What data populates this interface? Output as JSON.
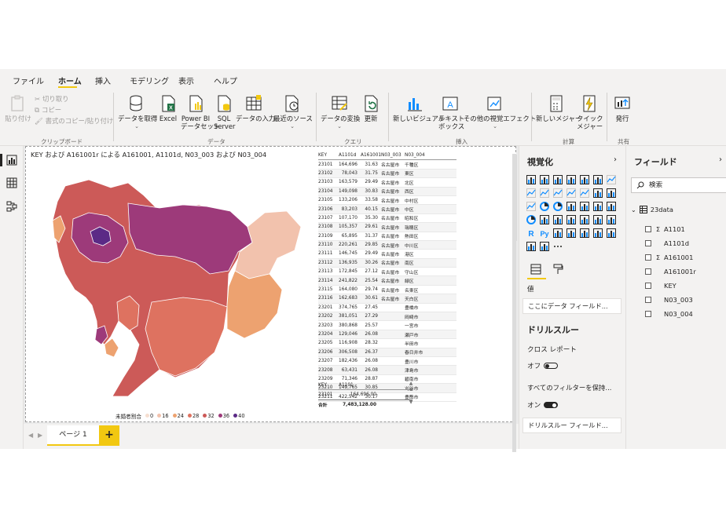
{
  "menu": {
    "tabs": [
      "ファイル",
      "ホーム",
      "挿入",
      "モデリング",
      "表示",
      "ヘルプ"
    ],
    "active": "ホーム"
  },
  "ribbon": {
    "clipboard": {
      "paste": "貼り付け",
      "cut": "切り取り",
      "copy": "コピー",
      "format_painter": "書式のコピー/貼り付け",
      "label": "クリップボード"
    },
    "data": {
      "get_data": "データを取得",
      "excel": "Excel",
      "pbi_dataset_1": "Power BI",
      "pbi_dataset_2": "データセット",
      "sql_1": "SQL",
      "sql_2": "Server",
      "enter_data": "データの入力",
      "recent_sources": "最近のソース",
      "label": "データ"
    },
    "queries": {
      "transform": "データの変換",
      "refresh": "更新",
      "label": "クエリ"
    },
    "insert": {
      "new_visual": "新しいビジュアル",
      "textbox_1": "テキスト",
      "textbox_2": "ボックス",
      "more_visuals": "その他の視覚エフェクト",
      "label": "挿入"
    },
    "calculations": {
      "new_measure": "新しいメジャー",
      "quick_measure_1": "クイック",
      "quick_measure_2": "メジャー",
      "label": "計算"
    },
    "share": {
      "publish": "発行",
      "label": "共有"
    }
  },
  "report": {
    "map_title": "KEY および A161001r による A161001, A1101d, N03_003 および N03_004",
    "legend": {
      "title": "未婚者割合",
      "items": [
        {
          "label": "0",
          "color": "#f6ded0"
        },
        {
          "label": "16",
          "color": "#f2c2ad"
        },
        {
          "label": "24",
          "color": "#eda270"
        },
        {
          "label": "28",
          "color": "#de7260"
        },
        {
          "label": "32",
          "color": "#cc5a58"
        },
        {
          "label": "36",
          "color": "#9d3a7a"
        },
        {
          "label": "40",
          "color": "#5b2a86"
        }
      ]
    },
    "table1": {
      "headers": [
        "KEY",
        "A1101d",
        "A161001",
        "N03_003",
        "N03_004"
      ],
      "rows": [
        [
          "23101",
          "164,696",
          "31.63",
          "名古屋市",
          "千種区"
        ],
        [
          "23102",
          "78,043",
          "31.75",
          "名古屋市",
          "東区"
        ],
        [
          "23103",
          "163,579",
          "29.49",
          "名古屋市",
          "北区"
        ],
        [
          "23104",
          "149,098",
          "30.83",
          "名古屋市",
          "西区"
        ],
        [
          "23105",
          "133,206",
          "33.58",
          "名古屋市",
          "中村区"
        ],
        [
          "23106",
          "83,203",
          "40.15",
          "名古屋市",
          "中区"
        ],
        [
          "23107",
          "107,170",
          "35.30",
          "名古屋市",
          "昭和区"
        ],
        [
          "23108",
          "105,357",
          "29.61",
          "名古屋市",
          "瑞穂区"
        ],
        [
          "23109",
          "65,895",
          "31.37",
          "名古屋市",
          "熱田区"
        ],
        [
          "23110",
          "220,261",
          "29.85",
          "名古屋市",
          "中川区"
        ],
        [
          "23111",
          "146,745",
          "29.49",
          "名古屋市",
          "港区"
        ],
        [
          "23112",
          "136,935",
          "30.26",
          "名古屋市",
          "南区"
        ],
        [
          "23113",
          "172,845",
          "27.12",
          "名古屋市",
          "守山区"
        ],
        [
          "23114",
          "241,822",
          "25.54",
          "名古屋市",
          "緑区"
        ],
        [
          "23115",
          "164,080",
          "29.74",
          "名古屋市",
          "名東区"
        ],
        [
          "23116",
          "162,683",
          "30.61",
          "名古屋市",
          "天白区"
        ],
        [
          "23201",
          "374,765",
          "27.45",
          "",
          "豊橋市"
        ],
        [
          "23202",
          "381,051",
          "27.29",
          "",
          "岡崎市"
        ],
        [
          "23203",
          "380,868",
          "25.57",
          "",
          "一宮市"
        ],
        [
          "23204",
          "129,046",
          "26.08",
          "",
          "瀬戸市"
        ],
        [
          "23205",
          "116,908",
          "28.32",
          "",
          "半田市"
        ],
        [
          "23206",
          "306,508",
          "26.37",
          "",
          "春日井市"
        ],
        [
          "23207",
          "182,436",
          "26.08",
          "",
          "豊川市"
        ],
        [
          "23208",
          "63,431",
          "26.08",
          "",
          "津島市"
        ],
        [
          "23209",
          "71,346",
          "28.87",
          "",
          "碧南市"
        ],
        [
          "23210",
          "149,765",
          "30.85",
          "",
          "刈谷市"
        ],
        [
          "23211",
          "422,542",
          "30.17",
          "",
          "豊田市"
        ]
      ]
    },
    "table2": {
      "headers": [
        "KEY",
        "A1101"
      ],
      "rows": [
        [
          "23101",
          "164,696.00"
        ]
      ],
      "total_label": "合計",
      "total_value": "7,483,128.00"
    }
  },
  "pages": {
    "tab": "ページ 1",
    "add": "+",
    "prev": "◀",
    "next": "▶"
  },
  "visualizations": {
    "title": "視覚化",
    "values_label": "値",
    "values_well": "ここにデータ フィールド...",
    "drill_title": "ドリルスルー",
    "cross_report": "クロス レポート",
    "cross_toggle": "オフ",
    "keep_filters": "すべてのフィルターを保持...",
    "keep_toggle": "オン",
    "drill_well": "ドリルスルー フィールド..."
  },
  "fields": {
    "title": "フィールド",
    "search_placeholder": "検索",
    "table_name": "23data",
    "items": [
      {
        "name": "A1101",
        "sigma": "Σ"
      },
      {
        "name": "A1101d",
        "sigma": ""
      },
      {
        "name": "A161001",
        "sigma": "Σ"
      },
      {
        "name": "A161001r",
        "sigma": ""
      },
      {
        "name": "KEY",
        "sigma": ""
      },
      {
        "name": "N03_003",
        "sigma": ""
      },
      {
        "name": "N03_004",
        "sigma": ""
      }
    ]
  },
  "colors": {
    "accent": "#f2c811",
    "ribbon_bg": "#f3f2f1"
  }
}
